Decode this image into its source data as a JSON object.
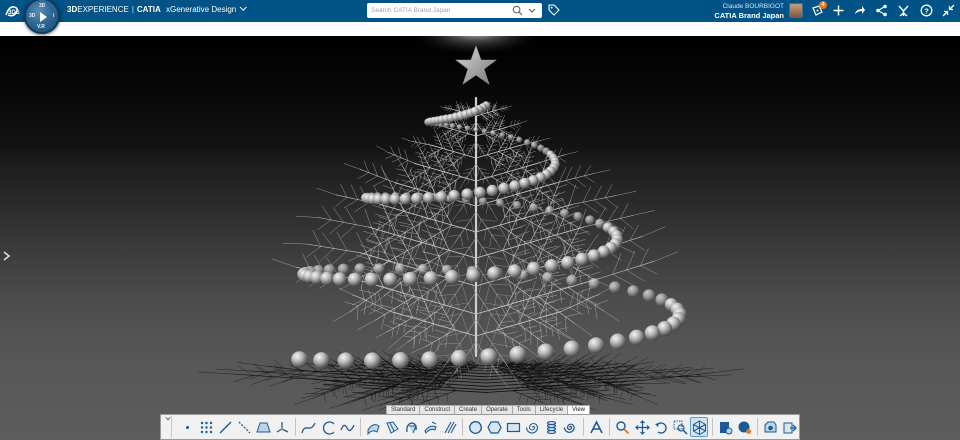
{
  "app": {
    "brand_prefix": "3D",
    "brand_main": "EXPERIENCE",
    "product": "CATIA",
    "app_name": "xGenerative Design",
    "compass_labels": {
      "top": "3D",
      "left": "3D",
      "right": "i",
      "bottom": "V.R"
    }
  },
  "search": {
    "placeholder": "Search CATIA Brand Japan"
  },
  "user": {
    "name": "Claude BOURBIGOT",
    "tenant": "CATIA Brand Japan",
    "notification_count": "4"
  },
  "topbar_icons": [
    "notifications-icon",
    "add-icon",
    "share-icon",
    "network-icon",
    "compass-apps-icon",
    "help-icon",
    "collapse-icon"
  ],
  "colors": {
    "topbar": "#005386",
    "badge": "#e87722",
    "active_tab": "#ffffff"
  },
  "action_bar": {
    "tabs": [
      "Standard",
      "Construct",
      "Create",
      "Operate",
      "Tools",
      "Lifecycle",
      "View"
    ],
    "active_tab": "View",
    "groups": [
      [
        "point-icon",
        "point-grid-icon",
        "line-icon",
        "dashed-line-icon",
        "plane-icon",
        "axis-system-icon"
      ],
      [
        "spline-icon",
        "arc-icon",
        "curve-icon"
      ],
      [
        "sweep-icon",
        "loft-icon",
        "revolve-icon",
        "multi-sweep-icon",
        "ruled-surface-icon"
      ],
      [
        "circle-icon",
        "hexagon-icon",
        "rectangle-icon",
        "spiral-icon",
        "helix-icon",
        "coil-icon"
      ],
      [
        "text-icon"
      ],
      [
        "zoom-icon",
        "pan-icon",
        "rotate-icon",
        "zoom-area-icon",
        "view-cube-icon"
      ],
      [
        "render-icon",
        "material-icon"
      ],
      [
        "capture-icon",
        "export-icon"
      ]
    ],
    "active_button": "view-cube-icon"
  }
}
